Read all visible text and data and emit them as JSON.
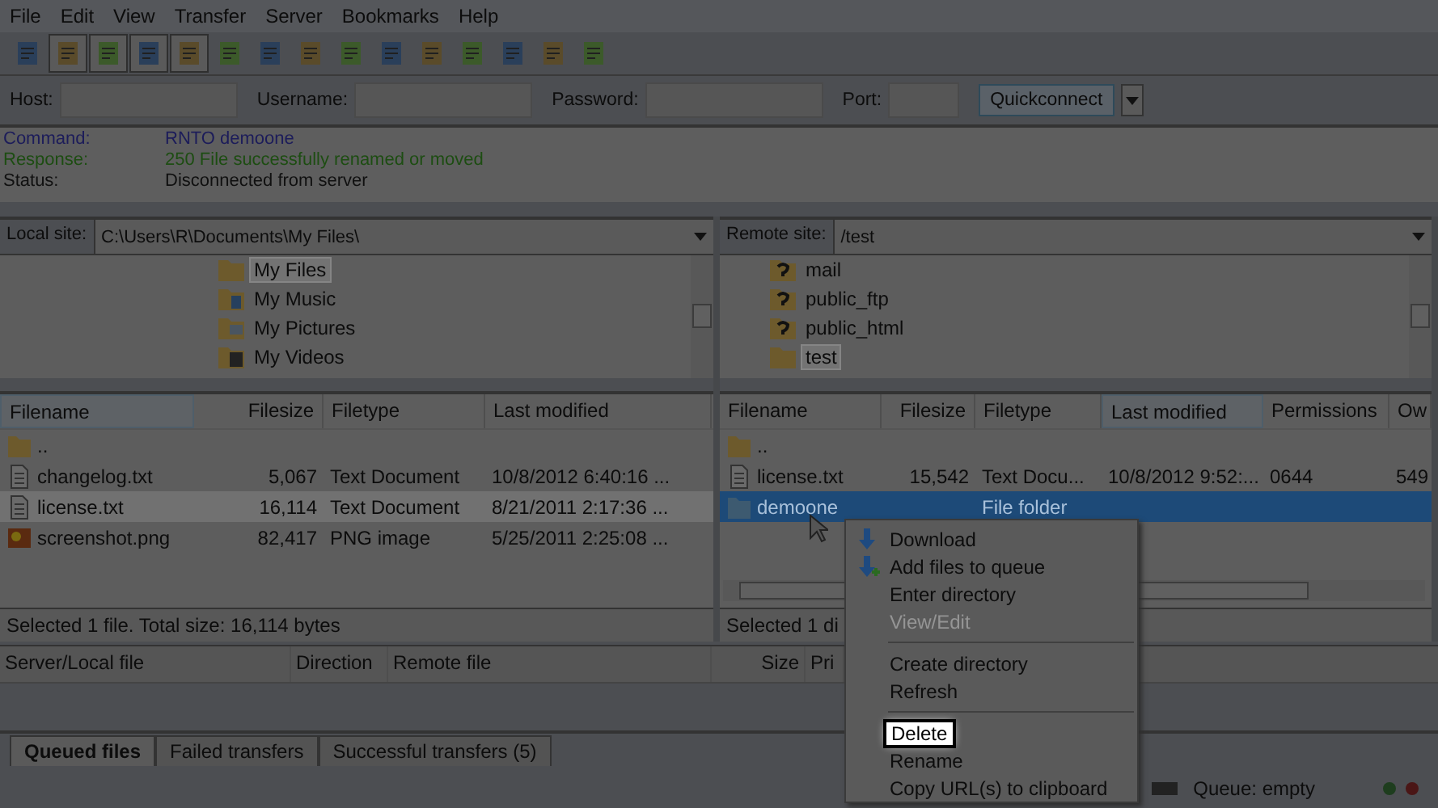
{
  "menu": [
    "File",
    "Edit",
    "View",
    "Transfer",
    "Server",
    "Bookmarks",
    "Help"
  ],
  "quickconnect": {
    "fields": [
      "Host:",
      "Username:",
      "Password:",
      "Port:"
    ],
    "button": "Quickconnect"
  },
  "log": [
    {
      "label": "Command:",
      "text": "RNTO demoone",
      "kind": "command"
    },
    {
      "label": "Response:",
      "text": "250 File successfully renamed or moved",
      "kind": "response"
    },
    {
      "label": "Status:",
      "text": "Disconnected from server",
      "kind": "status"
    }
  ],
  "local": {
    "site_label": "Local site:",
    "path": "C:\\Users\\R\\Documents\\My Files\\",
    "tree": [
      {
        "name": "My Files",
        "kind": "folder",
        "selected": true
      },
      {
        "name": "My Music",
        "kind": "music",
        "selected": false
      },
      {
        "name": "My Pictures",
        "kind": "pictures",
        "selected": false
      },
      {
        "name": "My Videos",
        "kind": "videos",
        "selected": false
      }
    ],
    "columns": [
      "Filename",
      "Filesize",
      "Filetype",
      "Last modified"
    ],
    "rows": [
      {
        "kind": "folder",
        "cells": [
          ".."
        ],
        "selected": false
      },
      {
        "kind": "text",
        "cells": [
          "changelog.txt",
          "5,067",
          "Text Document",
          "10/8/2012 6:40:16 ..."
        ],
        "selected": false
      },
      {
        "kind": "text",
        "cells": [
          "license.txt",
          "16,114",
          "Text Document",
          "8/21/2011 2:17:36 ..."
        ],
        "selected": true
      },
      {
        "kind": "image",
        "cells": [
          "screenshot.png",
          "82,417",
          "PNG image",
          "5/25/2011 2:25:08 ..."
        ],
        "selected": false
      }
    ],
    "status": "Selected 1 file. Total size: 16,114 bytes"
  },
  "remote": {
    "site_label": "Remote site:",
    "path": "/test",
    "tree": [
      {
        "name": "mail",
        "kind": "unknown",
        "selected": false
      },
      {
        "name": "public_ftp",
        "kind": "unknown",
        "selected": false
      },
      {
        "name": "public_html",
        "kind": "unknown",
        "selected": false
      },
      {
        "name": "test",
        "kind": "folder",
        "selected": true
      }
    ],
    "columns": [
      "Filename",
      "Filesize",
      "Filetype",
      "Last modified",
      "Permissions",
      "Ow"
    ],
    "rows": [
      {
        "kind": "folder",
        "cells": [
          ".."
        ],
        "selected": false
      },
      {
        "kind": "text",
        "cells": [
          "license.txt",
          "15,542",
          "Text Docu...",
          "10/8/2012 9:52:...",
          "0644",
          "549"
        ],
        "selected": false
      },
      {
        "kind": "folder",
        "cells": [
          "demoone",
          "",
          "File folder"
        ],
        "selected": true
      }
    ],
    "status": "Selected 1 di"
  },
  "context_menu": [
    {
      "kind": "download",
      "label": "Download",
      "disabled": false,
      "highlighted": false
    },
    {
      "kind": "add",
      "label": "Add files to queue",
      "disabled": false,
      "highlighted": false
    },
    {
      "kind": "item",
      "label": "Enter directory",
      "disabled": false,
      "highlighted": false
    },
    {
      "kind": "item",
      "label": "View/Edit",
      "disabled": true,
      "highlighted": false
    },
    {
      "kind": "separator"
    },
    {
      "kind": "item",
      "label": "Create directory",
      "disabled": false,
      "highlighted": false
    },
    {
      "kind": "item",
      "label": "Refresh",
      "disabled": false,
      "highlighted": false
    },
    {
      "kind": "separator"
    },
    {
      "kind": "item",
      "label": "Delete",
      "disabled": false,
      "highlighted": true
    },
    {
      "kind": "item",
      "label": "Rename",
      "disabled": false,
      "highlighted": false
    },
    {
      "kind": "item",
      "label": "Copy URL(s) to clipboard",
      "disabled": false,
      "highlighted": false
    }
  ],
  "queue": {
    "columns": [
      "Server/Local file",
      "Direction",
      "Remote file",
      "Size",
      "Pri"
    ],
    "tabs": [
      {
        "label": "Queued files",
        "selected": true
      },
      {
        "label": "Failed transfers",
        "selected": false
      },
      {
        "label": "Successful transfers (5)",
        "selected": false
      }
    ],
    "status": "Queue: empty"
  }
}
